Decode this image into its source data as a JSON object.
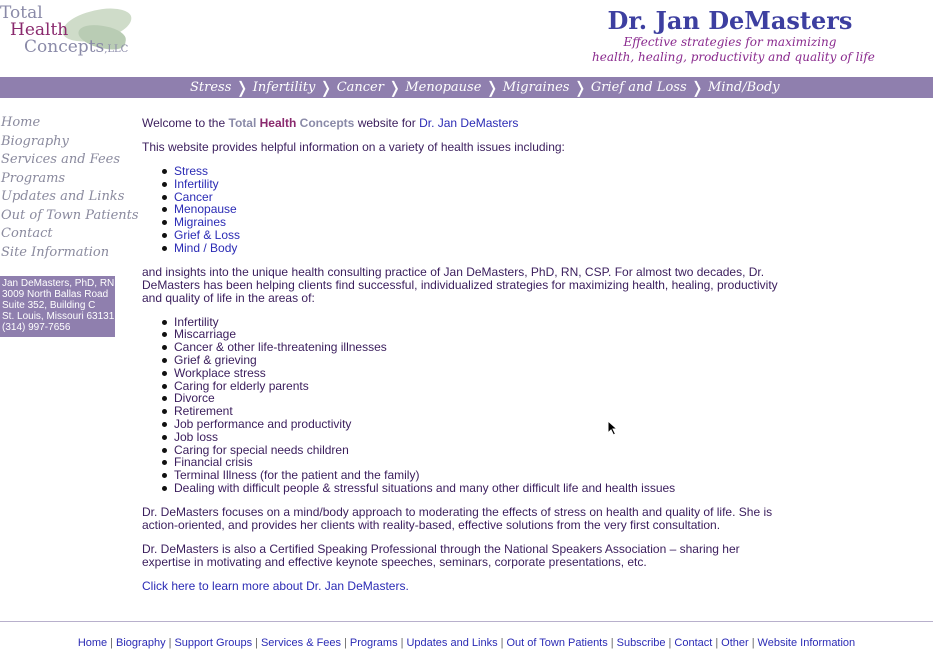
{
  "logo": {
    "line1": "Total",
    "line2": "Health",
    "line3": "Concepts",
    "line3_suffix": ",LLC"
  },
  "brand": {
    "title": "Dr. Jan DeMasters",
    "tagline1": "Effective strategies for maximizing",
    "tagline2": "health, healing, productivity and quality of life"
  },
  "topnav": [
    "Stress",
    "Infertility",
    "Cancer",
    "Menopause",
    "Migraines",
    "Grief and Loss",
    "Mind/Body"
  ],
  "sidebar": [
    "Home",
    "Biography",
    "Services and Fees",
    "Programs",
    "Updates and Links",
    "Out of Town Patients",
    "Contact",
    "Site Information"
  ],
  "address": [
    "Jan DeMasters, PhD, RN",
    "3009 North Ballas Road",
    "Suite 352, Building C",
    "St. Louis, Missouri 63131",
    "(314) 997-7656"
  ],
  "main": {
    "welcome_prefix": "Welcome to the",
    "welcome_thc1": "Total",
    "welcome_thc2": "Health",
    "welcome_thc3": "Concepts",
    "welcome_mid": "website for",
    "welcome_link": "Dr. Jan DeMasters",
    "intro": "This website provides helpful information on a variety of health issues including:",
    "issues": [
      "Stress",
      "Infertility",
      "Cancer",
      "Menopause",
      "Migraines",
      "Grief & Loss",
      "Mind / Body"
    ],
    "insights": "and insights into the unique health consulting practice of Jan DeMasters, PhD, RN, CSP. For almost two decades, Dr. DeMasters has been helping clients find successful, individualized strategies for maximizing health, healing, productivity and quality of life in the areas of:",
    "areas": [
      "Infertility",
      "Miscarriage",
      "Cancer & other life-threatening illnesses",
      "Grief & grieving",
      "Workplace stress",
      "Caring for elderly parents",
      "Divorce",
      "Retirement",
      "Job performance and productivity",
      "Job loss",
      "Caring for special needs children",
      "Financial crisis",
      "Terminal Illness (for the patient and the family)",
      "Dealing with difficult people & stressful situations and many other difficult life and health issues"
    ],
    "para_focus": "Dr. DeMasters focuses on a mind/body approach to moderating the effects of stress on health and quality of life. She is action-oriented, and provides her clients with reality-based, effective solutions from the very first consultation.",
    "para_speaker": "Dr. DeMasters is also a Certified Speaking Professional through the National Speakers Association – sharing her expertise in motivating and effective keynote speeches, seminars, corporate presentations, etc.",
    "learn_more": "Click here to learn more about Dr. Jan DeMasters."
  },
  "footer": [
    "Home",
    "Biography",
    "Support Groups",
    "Services & Fees",
    "Programs",
    "Updates and Links",
    "Out of Town Patients",
    "Subscribe",
    "Contact",
    "Other",
    "Website Information"
  ],
  "colors": {
    "nav_bar": "#8f7fae",
    "link": "#2b2bb5",
    "title": "#3d3fa0",
    "tagline": "#8a2a8e",
    "sidebar_text": "#8a8a9e"
  }
}
